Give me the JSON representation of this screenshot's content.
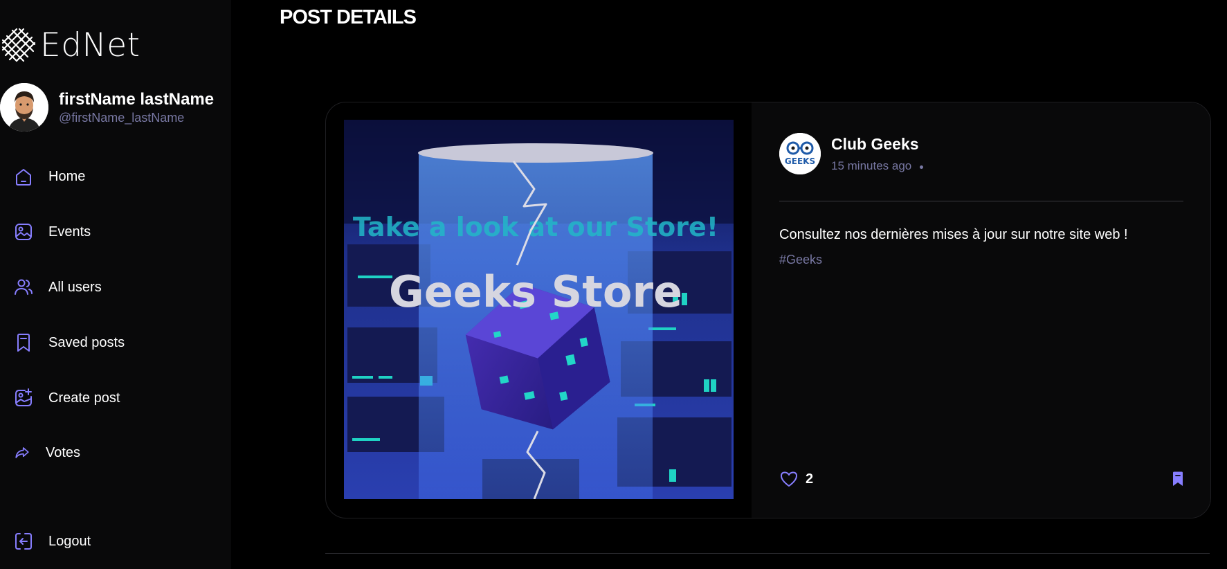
{
  "brand": {
    "name": "EdNet"
  },
  "user": {
    "name": "firstName lastName",
    "handle": "@firstName_lastName"
  },
  "nav": {
    "items": [
      {
        "label": "Home",
        "icon": "home-icon"
      },
      {
        "label": "Events",
        "icon": "gallery-icon"
      },
      {
        "label": "All users",
        "icon": "people-icon"
      },
      {
        "label": "Saved posts",
        "icon": "bookmark-icon"
      },
      {
        "label": "Create post",
        "icon": "gallery-add-icon"
      },
      {
        "label": "Votes",
        "icon": "share-arrow-icon"
      }
    ],
    "logout": "Logout"
  },
  "page": {
    "title": "POST DETAILS"
  },
  "post": {
    "author": "Club Geeks",
    "time": "15 minutes ago",
    "caption": "Consultez nos dernières mises à jour sur notre site web !",
    "tag": "#Geeks",
    "likes": "2",
    "image": {
      "headline": "Take a look at our Store!",
      "title": "Geeks Store",
      "avatar_text": "GEEKS"
    }
  },
  "colors": {
    "accent": "#877EFF",
    "muted": "#7878A3",
    "sidebar": "#09090A"
  }
}
